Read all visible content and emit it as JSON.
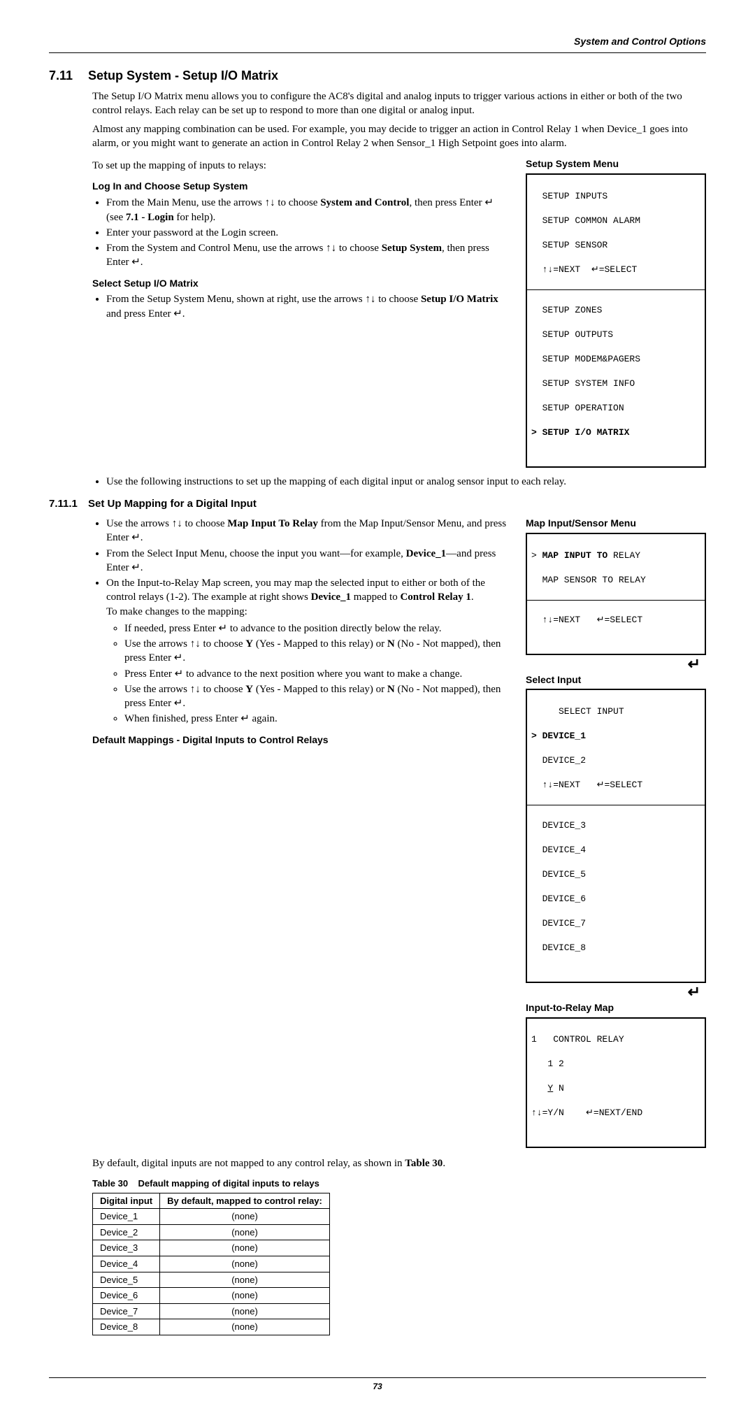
{
  "header": "System and Control Options",
  "section_num": "7.11",
  "section_title": "Setup System - Setup I/O Matrix",
  "intro_p1": "The Setup I/O Matrix menu allows you to configure the AC8's digital and analog inputs to trigger various actions in either or both of the two control relays. Each relay can be set up to respond to more than one digital or analog input.",
  "intro_p2": "Almost any mapping combination can be used. For example, you may decide to trigger an action in Control Relay 1 when Device_1 goes into alarm, or you might want to generate an action in Control Relay 2 when Sensor_1 High Setpoint goes into alarm.",
  "intro_p3": "To set up the mapping of inputs to relays:",
  "login_heading": "Log In and Choose Setup System",
  "login_b1a": "From the Main Menu, use the arrows ↑↓ to choose ",
  "login_b1b": "System and Control",
  "login_b1c": ", then press Enter ↵ (see ",
  "login_b1d": "7.1 - Login",
  "login_b1e": " for help).",
  "login_b2": "Enter your password at the Login screen.",
  "login_b3a": "From the System and Control Menu, use the arrows ↑↓ to choose ",
  "login_b3b": "Setup System",
  "login_b3c": ", then press Enter ↵.",
  "select_heading": "Select Setup I/O Matrix",
  "select_b1a": "From the Setup System Menu, shown at right, use the arrows ↑↓ to choose ",
  "select_b1b": "Setup I/O Matrix",
  "select_b1c": " and press Enter ↵.",
  "select_b2": "Use the following instructions to set up the mapping of each digital input or analog sensor input to each relay.",
  "sub_num": "7.11.1",
  "sub_title": "Set Up Mapping for a Digital Input",
  "map_b1a": "Use the arrows ↑↓ to choose ",
  "map_b1b": "Map Input To Relay",
  "map_b1c": " from the Map Input/Sensor Menu, and press Enter ↵.",
  "map_b2a": "From the Select Input Menu, choose the input you want—for example, ",
  "map_b2b": "Device_1",
  "map_b2c": "—and press Enter ↵.",
  "map_b3a": "On the Input-to-Relay Map screen, you may map the selected input to either or both of the control relays (1-2). The example at right shows ",
  "map_b3b": "Device_1",
  "map_b3c": " mapped to ",
  "map_b3d": "Control Relay 1",
  "map_b3e": ".",
  "map_p_changes": "To make changes to the mapping:",
  "map_s1": "If needed, press Enter ↵ to advance to the position directly below the relay.",
  "map_s2a": "Use the arrows ↑↓ to choose ",
  "map_s2b": "Y",
  "map_s2c": " (Yes - Mapped to this relay) or ",
  "map_s2d": "N",
  "map_s2e": " (No - Not mapped), then press Enter ↵.",
  "map_s3": "Press Enter ↵ to advance to the next position where you want to make a change.",
  "map_s4a": "Use the arrows ↑↓ to choose ",
  "map_s4b": "Y",
  "map_s4c": " (Yes - Mapped to this relay) or ",
  "map_s4d": "N",
  "map_s4e": " (No - Not mapped), then press Enter ↵.",
  "map_s5": "When finished, press Enter ↵ again.",
  "default_heading": "Default Mappings - Digital Inputs to Control Relays",
  "default_p_a": "By default, digital inputs are not mapped to any control relay, as shown in ",
  "default_p_b": "Table 30",
  "default_p_c": ".",
  "table_caption_a": "Table 30",
  "table_caption_b": "Default mapping of digital inputs to relays",
  "table_h1": "Digital input",
  "table_h2": "By default, mapped to control relay:",
  "table_rows": [
    [
      "Device_1",
      "(none)"
    ],
    [
      "Device_2",
      "(none)"
    ],
    [
      "Device_3",
      "(none)"
    ],
    [
      "Device_4",
      "(none)"
    ],
    [
      "Device_5",
      "(none)"
    ],
    [
      "Device_6",
      "(none)"
    ],
    [
      "Device_7",
      "(none)"
    ],
    [
      "Device_8",
      "(none)"
    ]
  ],
  "menu1_title": "Setup System Menu",
  "menu1": {
    "l1": "  SETUP INPUTS",
    "l2": "  SETUP COMMON ALARM",
    "l3": "  SETUP SENSOR",
    "l4": "  ↑↓=NEXT  ↵=SELECT",
    "l5": "  SETUP ZONES",
    "l6": "  SETUP OUTPUTS",
    "l7": "  SETUP MODEM&PAGERS",
    "l8": "  SETUP SYSTEM INFO",
    "l9": "  SETUP OPERATION",
    "l10": "> SETUP I/O MATRIX"
  },
  "menu2_title": "Map Input/Sensor Menu",
  "menu2": {
    "l1": "> MAP INPUT TO RELAY",
    "l1a": "> ",
    "l1b": "MAP INPUT TO",
    "l1c": " RELAY",
    "l2": "  MAP SENSOR TO RELAY",
    "l3": "  ↑↓=NEXT   ↵=SELECT"
  },
  "menu3_title": "Select Input",
  "menu3": {
    "l1": "     SELECT INPUT",
    "l2": "> DEVICE_1",
    "l3": "  DEVICE_2",
    "l4": "  ↑↓=NEXT   ↵=SELECT",
    "l5": "  DEVICE_3",
    "l6": "  DEVICE_4",
    "l7": "  DEVICE_5",
    "l8": "  DEVICE_6",
    "l9": "  DEVICE_7",
    "l10": "  DEVICE_8"
  },
  "menu4_title": "Input-to-Relay Map",
  "menu4": {
    "l1": "1   CONTROL RELAY",
    "l2": "   1 2",
    "l3a": "   ",
    "l3b": "Y",
    "l3c": " N",
    "l4": "↑↓=Y/N    ↵=NEXT/END"
  },
  "page_num": "73"
}
